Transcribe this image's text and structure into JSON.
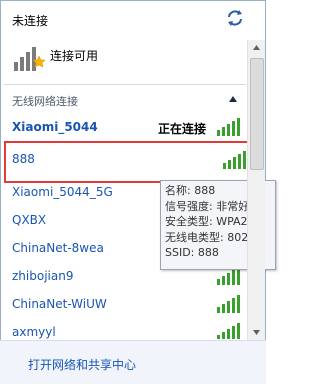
{
  "header": {
    "status_text": "未连接",
    "refresh_icon": "refresh-arrows-icon",
    "network_state_text": "连接可用",
    "network_state_icon": "signal-with-star-icon"
  },
  "section": {
    "title": "无线网络连接",
    "toggle_icon": "chevron-up-icon"
  },
  "networks": [
    {
      "name": "Xiaomi_5044",
      "status": "正在连接",
      "signal_icon": "signal-full-icon"
    },
    {
      "name": "888",
      "signal_icon": "signal-full-icon"
    },
    {
      "name": "Xiaomi_5044_5G",
      "signal_icon": "signal-full-icon"
    },
    {
      "name": "QXBX",
      "signal_icon": "signal-full-icon"
    },
    {
      "name": "ChinaNet-8wea",
      "signal_icon": "signal-full-icon"
    },
    {
      "name": "zhibojian9",
      "signal_icon": "signal-full-icon"
    },
    {
      "name": "ChinaNet-WiUW",
      "signal_icon": "signal-full-icon"
    },
    {
      "name": "axmyyl",
      "signal_icon": "signal-full-icon"
    }
  ],
  "tooltip": {
    "line1": "名称: 888",
    "line2": "信号强度: 非常好",
    "line3": "安全类型: WPA2-P",
    "line4": "无线电类型: 802.11",
    "line5": "SSID: 888"
  },
  "footer": {
    "link_text": "打开网络和共享中心"
  }
}
